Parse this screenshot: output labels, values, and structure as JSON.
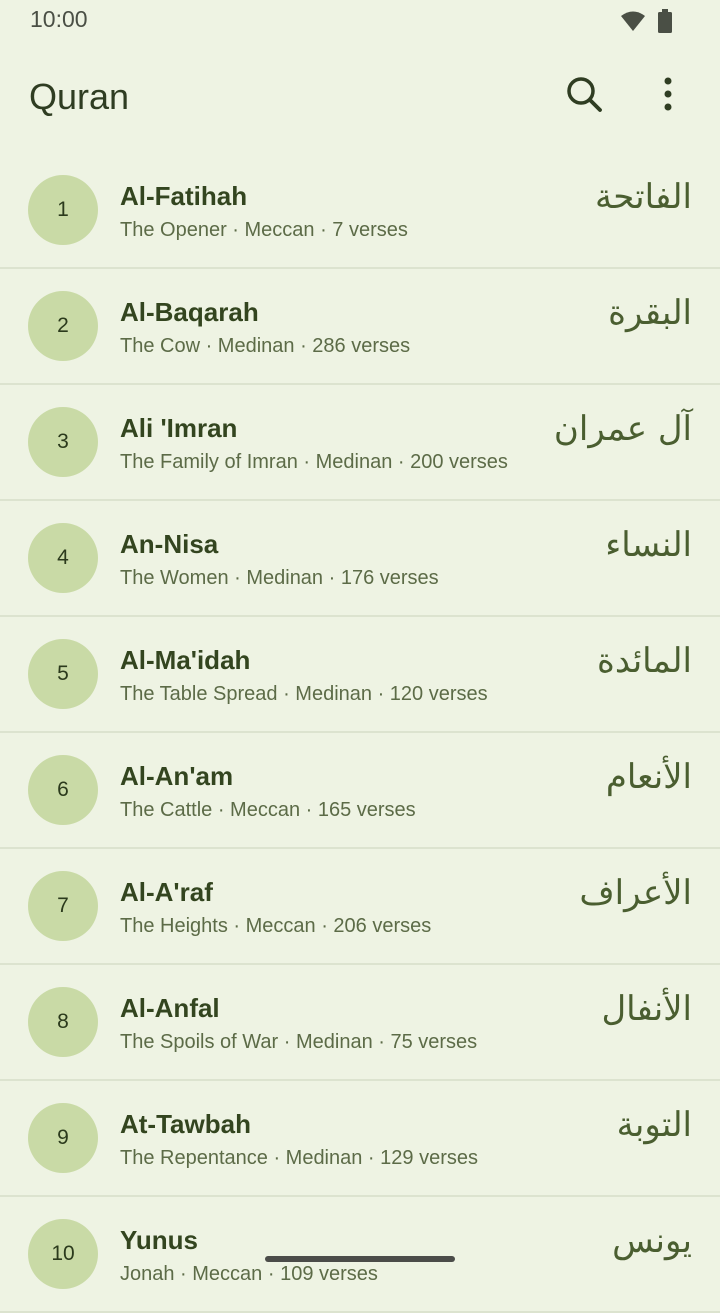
{
  "status": {
    "time": "10:00",
    "icons": [
      "wifi-icon",
      "battery-icon"
    ]
  },
  "app_bar": {
    "title": "Quran",
    "actions": [
      "search-icon",
      "more-vert-icon"
    ]
  },
  "colors": {
    "background": "#EEF3E3",
    "badge": "#C9DAA6",
    "primary_text": "#33451F",
    "secondary_text": "#5C6B47"
  },
  "surahs": [
    {
      "number": "1",
      "name": "Al-Fatihah",
      "meta": "The Opener · Meccan · 7 verses",
      "arabic": "الفاتحة"
    },
    {
      "number": "2",
      "name": "Al-Baqarah",
      "meta": "The Cow · Medinan · 286 verses",
      "arabic": "البقرة"
    },
    {
      "number": "3",
      "name": "Ali 'Imran",
      "meta": "The Family of Imran · Medinan · 200 verses",
      "arabic": "آل عمران"
    },
    {
      "number": "4",
      "name": "An-Nisa",
      "meta": "The Women · Medinan · 176 verses",
      "arabic": "النساء"
    },
    {
      "number": "5",
      "name": "Al-Ma'idah",
      "meta": "The Table Spread · Medinan · 120 verses",
      "arabic": "المائدة"
    },
    {
      "number": "6",
      "name": "Al-An'am",
      "meta": "The Cattle · Meccan · 165 verses",
      "arabic": "الأنعام"
    },
    {
      "number": "7",
      "name": "Al-A'raf",
      "meta": "The Heights · Meccan · 206 verses",
      "arabic": "الأعراف"
    },
    {
      "number": "8",
      "name": "Al-Anfal",
      "meta": "The Spoils of War · Medinan · 75 verses",
      "arabic": "الأنفال"
    },
    {
      "number": "9",
      "name": "At-Tawbah",
      "meta": "The Repentance · Medinan · 129 verses",
      "arabic": "التوبة"
    },
    {
      "number": "10",
      "name": "Yunus",
      "meta": "Jonah · Meccan · 109 verses",
      "arabic": "يونس"
    }
  ]
}
